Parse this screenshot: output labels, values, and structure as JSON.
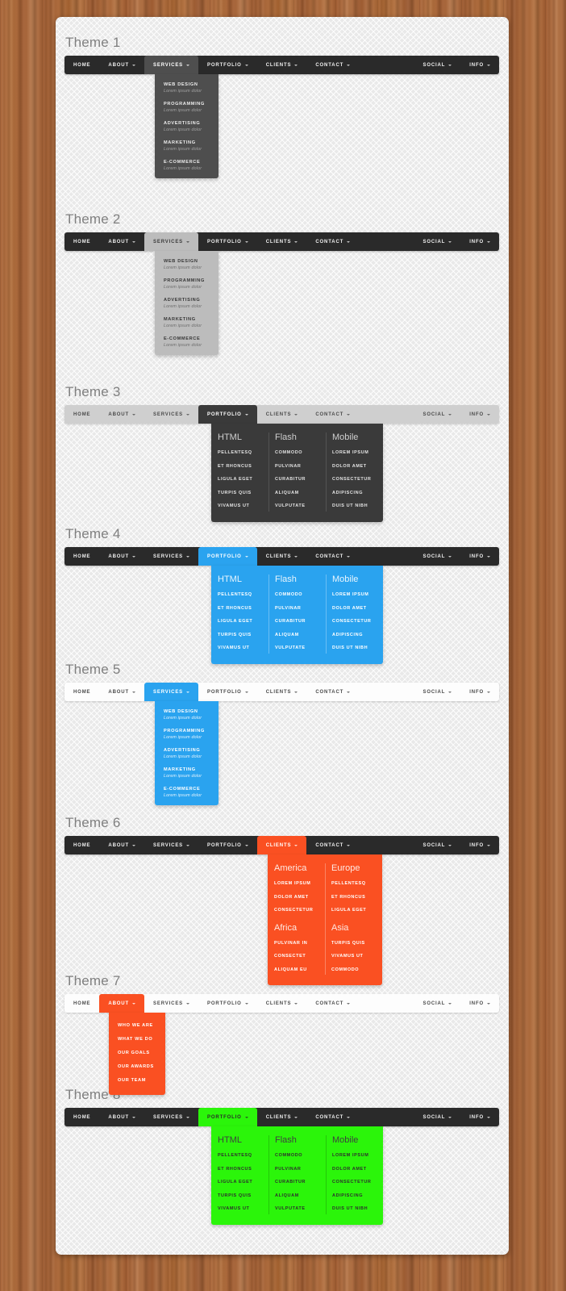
{
  "nav": {
    "items": [
      "HOME",
      "ABOUT",
      "SERVICES",
      "PORTFOLIO",
      "CLIENTS",
      "CONTACT"
    ],
    "right_items": [
      "SOCIAL",
      "INFO"
    ],
    "caret_icon": "chevron-down-icon"
  },
  "services_menu": [
    {
      "title": "WEB DESIGN",
      "sub": "Lorem ipsum dolor"
    },
    {
      "title": "PROGRAMMING",
      "sub": "Lorem ipsum dolor"
    },
    {
      "title": "ADVERTISING",
      "sub": "Lorem ipsum dolor"
    },
    {
      "title": "MARKETING",
      "sub": "Lorem ipsum dolor"
    },
    {
      "title": "E-COMMERCE",
      "sub": "Lorem ipsum dolor"
    }
  ],
  "about_menu": [
    "WHO WE ARE",
    "WHAT WE DO",
    "OUR GOALS",
    "OUR AWARDS",
    "OUR TEAM"
  ],
  "portfolio_menu": {
    "columns": [
      {
        "head": "HTML",
        "links": [
          "PELLENTESQ",
          "ET RHONCUS",
          "LIGULA EGET",
          "TURPIS QUIS",
          "VIVAMUS UT"
        ]
      },
      {
        "head": "Flash",
        "links": [
          "COMMODO",
          "PULVINAR",
          "CURABITUR",
          "ALIQUAM",
          "VULPUTATE"
        ]
      },
      {
        "head": "Mobile",
        "links": [
          "LOREM IPSUM",
          "DOLOR AMET",
          "CONSECTETUR",
          "ADIPISCING",
          "DUIS UT NIBH"
        ]
      }
    ]
  },
  "clients_menu": {
    "columns": [
      {
        "groups": [
          {
            "head": "America",
            "links": [
              "LOREM IPSUM",
              "DOLOR AMET",
              "CONSECTETUR"
            ]
          },
          {
            "head": "Africa",
            "links": [
              "PULVINAR IN",
              "CONSECTET",
              "ALIQUAM EU"
            ]
          }
        ]
      },
      {
        "groups": [
          {
            "head": "Europe",
            "links": [
              "PELLENTESQ",
              "ET RHONCUS",
              "LIGULA EGET"
            ]
          },
          {
            "head": "Asia",
            "links": [
              "TURPIS QUIS",
              "VIVAMUS UT",
              "COMMODO"
            ]
          }
        ]
      }
    ]
  },
  "themes": [
    {
      "label": "Theme 1"
    },
    {
      "label": "Theme 2"
    },
    {
      "label": "Theme 3"
    },
    {
      "label": "Theme 4"
    },
    {
      "label": "Theme 5"
    },
    {
      "label": "Theme 6"
    },
    {
      "label": "Theme 7"
    },
    {
      "label": "Theme 8"
    }
  ],
  "colors": {
    "wood_background": "#a9663a",
    "panel": "#e9e9e9",
    "dark_bar": "#2a2a2a",
    "gray_bar": "#cfcfcf",
    "white_bar": "#fdfdfd",
    "accent_blue": "#2aa3ef",
    "accent_orange": "#fa5022",
    "accent_green": "#2bf50a",
    "title_text": "#808080"
  }
}
